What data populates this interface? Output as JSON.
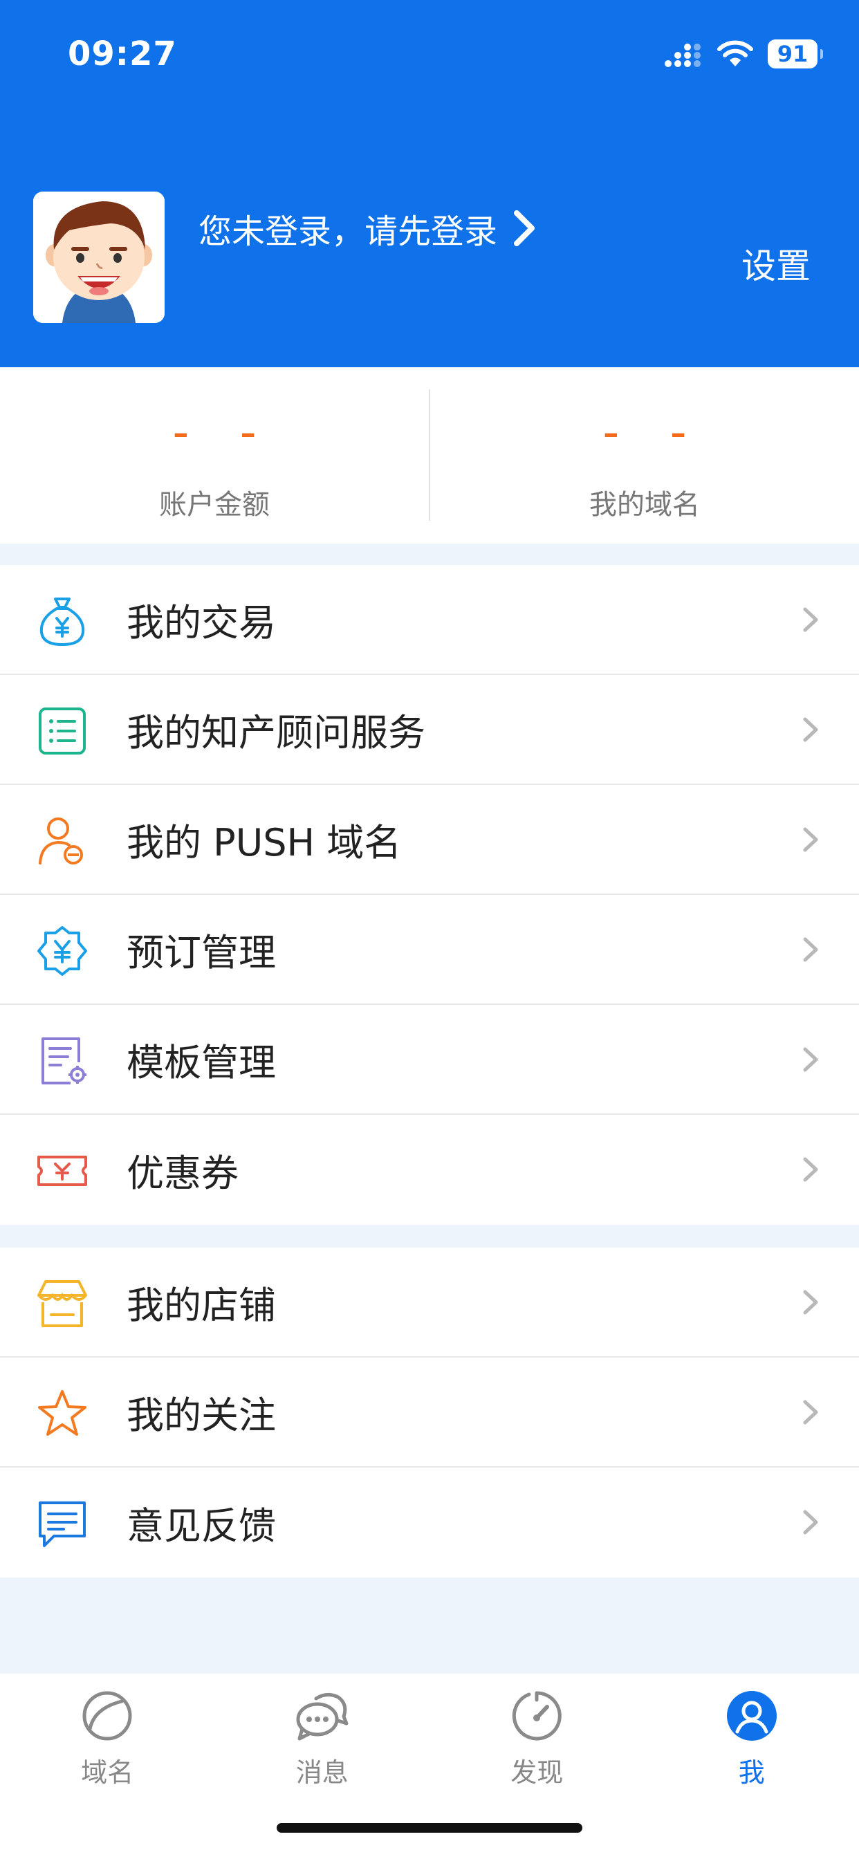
{
  "status_bar": {
    "time": "09:27",
    "battery": "91"
  },
  "header": {
    "login_prompt": "您未登录，请先登录",
    "settings_label": "设置"
  },
  "stats": [
    {
      "value": "– –",
      "label": "账户金额"
    },
    {
      "value": "– –",
      "label": "我的域名"
    }
  ],
  "menu_group_1": [
    {
      "label": "我的交易",
      "icon": "money-bag-icon"
    },
    {
      "label": "我的知产顾问服务",
      "icon": "list-icon"
    },
    {
      "label": "我的 PUSH 域名",
      "icon": "user-e-icon"
    },
    {
      "label": "预订管理",
      "icon": "yen-badge-icon"
    },
    {
      "label": "模板管理",
      "icon": "document-gear-icon"
    },
    {
      "label": "优惠券",
      "icon": "coupon-icon"
    }
  ],
  "menu_group_2": [
    {
      "label": "我的店铺",
      "icon": "store-icon"
    },
    {
      "label": "我的关注",
      "icon": "star-icon"
    },
    {
      "label": "意见反馈",
      "icon": "feedback-icon"
    }
  ],
  "tabbar": [
    {
      "label": "域名",
      "icon": "domain-icon",
      "active": false
    },
    {
      "label": "消息",
      "icon": "message-icon",
      "active": false
    },
    {
      "label": "发现",
      "icon": "discover-icon",
      "active": false
    },
    {
      "label": "我",
      "icon": "me-icon",
      "active": true
    }
  ],
  "colors": {
    "brand_blue": "#0f72ea",
    "stat_orange": "#f36a18",
    "background": "#eef4fc"
  }
}
